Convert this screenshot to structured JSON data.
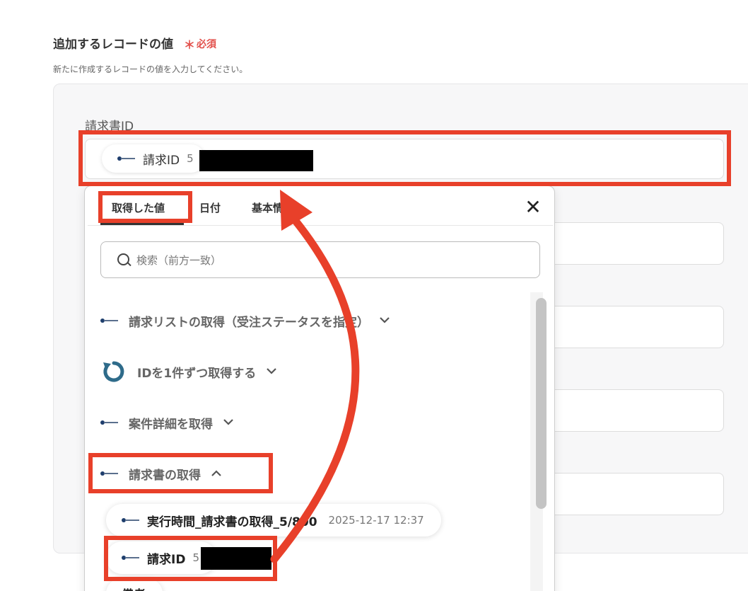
{
  "form": {
    "section_title": "追加するレコードの値",
    "required_star": "＊",
    "required_text": "必須",
    "description": "新たに作成するレコードの値を入力してください。",
    "field_label": "請求書ID",
    "field_chip": {
      "icon": "board-logo-icon",
      "label": "請求ID",
      "value": "5"
    }
  },
  "popup": {
    "tabs": [
      "取得した値",
      "日付",
      "基本情"
    ],
    "active_tab": "取得した値",
    "close_glyph": "✕",
    "search_placeholder": "検索（前方一致）",
    "groups": [
      {
        "label": "請求リストの取得（受注ステータスを指定）",
        "icon": "board-logo-icon",
        "expanded": false
      },
      {
        "label": "IDを1件ずつ取得する",
        "icon": "loop-icon",
        "expanded": false
      },
      {
        "label": "案件詳細を取得",
        "icon": "board-logo-icon",
        "expanded": false
      },
      {
        "label": "請求書の取得",
        "icon": "board-logo-icon",
        "expanded": true
      }
    ],
    "outputs": [
      {
        "label": "実行時間_請求書の取得_5",
        "label_after_arrow": "/800",
        "value": "2025-12-17 12:37"
      },
      {
        "label": "請求ID",
        "value": "5"
      },
      {
        "label": "備考",
        "value": ""
      }
    ],
    "chevron_down": "⌄",
    "chevron_up": "^"
  },
  "colors": {
    "annotation_red": "#e8402a",
    "required_red": "#e2504b",
    "loop_icon": "#2e6b8a"
  }
}
